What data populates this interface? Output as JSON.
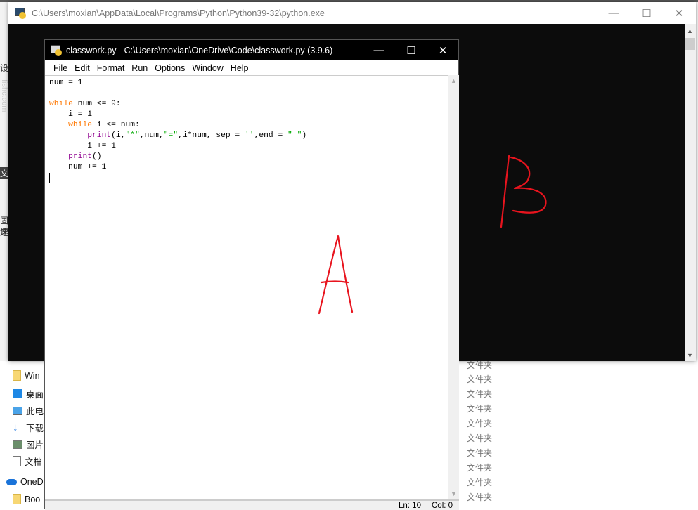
{
  "console": {
    "title": "C:\\Users\\moxian\\AppData\\Local\\Programs\\Python\\Python39-32\\python.exe"
  },
  "idle": {
    "title": "classwork.py - C:\\Users\\moxian\\OneDrive\\Code\\classwork.py (3.9.6)",
    "menu": [
      "File",
      "Edit",
      "Format",
      "Run",
      "Options",
      "Window",
      "Help"
    ],
    "code": [
      [
        [
          "t",
          "num = 1"
        ]
      ],
      [],
      [
        [
          "kw",
          "while"
        ],
        [
          "t",
          " num <= 9:"
        ]
      ],
      [
        [
          "t",
          "    i = 1"
        ]
      ],
      [
        [
          "t",
          "    "
        ],
        [
          "kw",
          "while"
        ],
        [
          "t",
          " i <= num:"
        ]
      ],
      [
        [
          "t",
          "        "
        ],
        [
          "bi",
          "print"
        ],
        [
          "t",
          "(i,"
        ],
        [
          "st",
          "\"*\""
        ],
        [
          "t",
          ",num,"
        ],
        [
          "st",
          "\"=\""
        ],
        [
          "t",
          ",i*num, sep = "
        ],
        [
          "st",
          "''"
        ],
        [
          "t",
          ",end = "
        ],
        [
          "st",
          "\" \""
        ],
        [
          "t",
          ")"
        ]
      ],
      [
        [
          "t",
          "        i += 1"
        ]
      ],
      [
        [
          "t",
          "    "
        ],
        [
          "bi",
          "print"
        ],
        [
          "t",
          "()"
        ]
      ],
      [
        [
          "t",
          "    num += 1"
        ]
      ],
      []
    ],
    "status": {
      "ln": "Ln: 10",
      "col": "Col: 0"
    }
  },
  "window_controls": {
    "minimize": "—",
    "maximize": "☐",
    "close": "✕"
  },
  "background": {
    "left_strip": [
      "设",
      "fishc.com",
      "文",
      "固定",
      "速"
    ],
    "nav_items": [
      {
        "label": "Win",
        "icon": "folder-icon"
      },
      {
        "label": "桌面",
        "icon": "desktop-icon"
      },
      {
        "label": "此电",
        "icon": "pc-icon"
      },
      {
        "label": "下载",
        "icon": "download-icon"
      },
      {
        "label": "图片",
        "icon": "pictures-icon"
      },
      {
        "label": "文档",
        "icon": "documents-icon"
      },
      {
        "label": "OneD",
        "icon": "onedrive-icon"
      },
      {
        "label": "Boo",
        "icon": "folder-icon"
      }
    ],
    "type_cells": [
      "文件夹",
      "文件夹",
      "文件夹",
      "文件夹",
      "文件夹",
      "文件夹",
      "文件夹",
      "文件夹",
      "文件夹",
      "文件夹"
    ]
  },
  "annotations": {
    "a": "A",
    "b": "B",
    "color": "#e8141e"
  }
}
